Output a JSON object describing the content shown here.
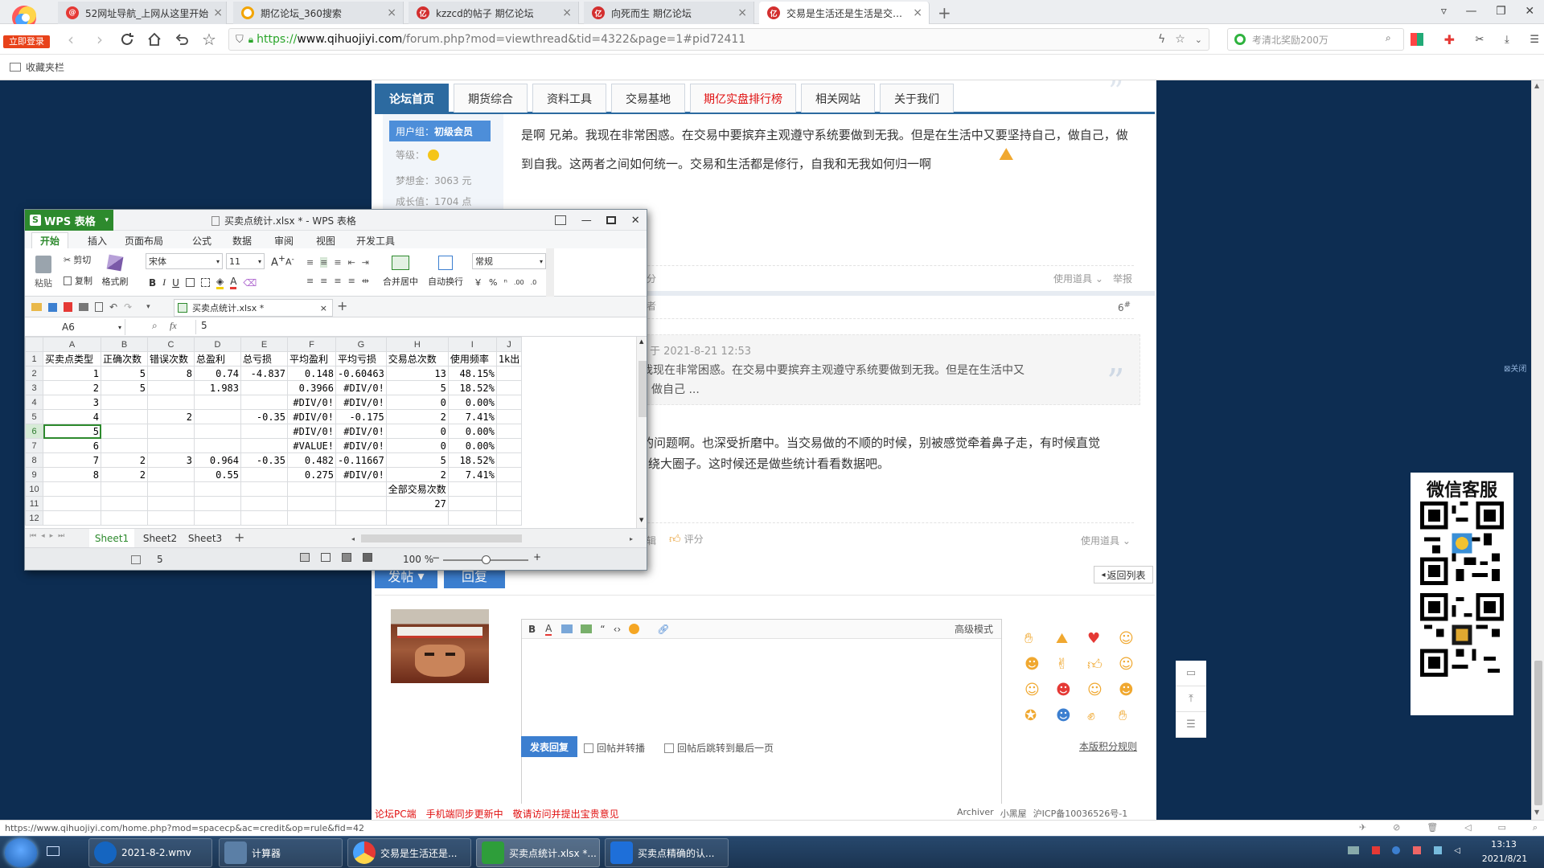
{
  "browser": {
    "login_badge": "立即登录",
    "tabs": [
      {
        "title": "52网址导航_上网从这里开始",
        "icon": "spiral",
        "color": "#e53935"
      },
      {
        "title": "期亿论坛_360搜索",
        "icon": "360",
        "color": "#f2a400"
      },
      {
        "title": "kzzcd的帖子 期亿论坛",
        "icon": "forum",
        "color": "#d32f2f"
      },
      {
        "title": "向死而生 期亿论坛",
        "icon": "forum",
        "color": "#d32f2f"
      },
      {
        "title": "交易是生活还是生活是交易？",
        "icon": "forum",
        "color": "#d32f2f",
        "active": true
      }
    ],
    "url_protocol": "https://",
    "url_host": "www.qihuojiyi.com",
    "url_rest": "/forum.php?mod=viewthread&tid=4322&page=1#pid72411",
    "search_placeholder": "考清北奖励200万",
    "favbar_label": "收藏夹栏"
  },
  "forum": {
    "nav": [
      "论坛首页",
      "期货综合",
      "资料工具",
      "交易基地",
      "期亿实盘排行榜",
      "相关网站",
      "关于我们"
    ],
    "sidebar": {
      "group_label": "用户组：",
      "group_value": "初级会员",
      "level_label": "等级：",
      "coins": "梦想金：3063 元",
      "growth": "成长值：1704 点"
    },
    "post1": {
      "text": "是啊 兄弟。我现在非常困惑。在交易中要摈弃主观遵守系统要做到无我。但是在生活中又要坚持自己，做自己，做到自我。这两者之间如何统一。交易和生活都是修行，自我和无我如何归一啊",
      "rate_partial": "分",
      "tools": "使用道具",
      "report": "举报"
    },
    "post2": {
      "floor": "6",
      "floor_sup": "#",
      "author_partial": "者",
      "quote_time": "于 2021-8-21 12:53",
      "quote_text": "我现在非常困惑。在交易中要摈弃主观遵守系统要做到无我。但是在生活中又",
      "quote_text2": "做自己 ...",
      "reply_text": "的问题啊。也深受折磨中。当交易做的不顺的时候，别被感觉牵着鼻子走，有时候直觉",
      "reply_text2": "绕大圈子。这时候还是做些统计看看数据吧。",
      "edit_partial": "辑",
      "rate": "评分",
      "tools": "使用道具"
    },
    "buttons": {
      "post": "发帖",
      "reply": "回复",
      "back": "返回列表"
    },
    "editor": {
      "advanced": "高级模式",
      "submit": "发表回复",
      "check1": "回帖并转播",
      "check2": "回帖后跳转到最后一页",
      "rules": "本版积分规则"
    },
    "footer_red": "论坛PC端　手机端同步更新中　敬请访问并提出宝贵意见",
    "footer_right1": "Archiver",
    "footer_right2": "小黑屋",
    "footer_right3": "沪ICP备10036526号-1",
    "close_ad": "关闭"
  },
  "wechat": {
    "title": "微信客服"
  },
  "wps": {
    "app_name": "WPS 表格",
    "window_title": "买卖点统计.xlsx * - WPS 表格",
    "ribbon_tabs": [
      "开始",
      "插入",
      "页面布局",
      "公式",
      "数据",
      "审阅",
      "视图",
      "开发工具"
    ],
    "ribbon": {
      "paste": "粘贴",
      "cut": "剪切",
      "copy": "复制",
      "format_painter": "格式刷",
      "font_name": "宋体",
      "font_size": "11",
      "merge": "合并居中",
      "wrap": "自动换行",
      "number_format": "常规"
    },
    "doc_tab": "买卖点统计.xlsx *",
    "name_box": "A6",
    "fx": "fx",
    "formula": "5",
    "columns": [
      "A",
      "B",
      "C",
      "D",
      "E",
      "F",
      "G",
      "H",
      "I",
      "J"
    ],
    "rows": [
      {
        "n": "1",
        "c": [
          "买卖点类型",
          "正确次数",
          "错误次数",
          "总盈利",
          "总亏损",
          "平均盈利",
          "平均亏损",
          "交易总次数",
          "使用频率",
          "1k出"
        ]
      },
      {
        "n": "2",
        "c": [
          "1",
          "5",
          "8",
          "0.74",
          "-4.837",
          "0.148",
          "-0.60463",
          "13",
          "48.15%",
          ""
        ]
      },
      {
        "n": "3",
        "c": [
          "2",
          "5",
          "",
          "1.983",
          "",
          "0.3966",
          "#DIV/0!",
          "5",
          "18.52%",
          ""
        ]
      },
      {
        "n": "4",
        "c": [
          "3",
          "",
          "",
          "",
          "",
          "#DIV/0!",
          "#DIV/0!",
          "0",
          "0.00%",
          ""
        ]
      },
      {
        "n": "5",
        "c": [
          "4",
          "",
          "2",
          "",
          "-0.35",
          "#DIV/0!",
          "-0.175",
          "2",
          "7.41%",
          ""
        ]
      },
      {
        "n": "6",
        "c": [
          "5",
          "",
          "",
          "",
          "",
          "#DIV/0!",
          "#DIV/0!",
          "0",
          "0.00%",
          ""
        ]
      },
      {
        "n": "7",
        "c": [
          "6",
          "",
          "",
          "",
          "",
          "#VALUE!",
          "#DIV/0!",
          "0",
          "0.00%",
          ""
        ]
      },
      {
        "n": "8",
        "c": [
          "7",
          "2",
          "3",
          "0.964",
          "-0.35",
          "0.482",
          "-0.11667",
          "5",
          "18.52%",
          ""
        ]
      },
      {
        "n": "9",
        "c": [
          "8",
          "2",
          "",
          "0.55",
          "",
          "0.275",
          "#DIV/0!",
          "2",
          "7.41%",
          ""
        ]
      },
      {
        "n": "10",
        "c": [
          "",
          "",
          "",
          "",
          "",
          "",
          "",
          "全部交易次数",
          "",
          ""
        ]
      },
      {
        "n": "11",
        "c": [
          "",
          "",
          "",
          "",
          "",
          "",
          "",
          "27",
          "",
          ""
        ]
      },
      {
        "n": "12",
        "c": [
          "",
          "",
          "",
          "",
          "",
          "",
          "",
          "",
          "",
          ""
        ]
      }
    ],
    "sheets": [
      "Sheet1",
      "Sheet2",
      "Sheet3"
    ],
    "status_value": "5",
    "zoom": "100 %",
    "zoom_level": 0.5
  },
  "statusbar_url": "https://www.qihuojiyi.com/home.php?mod=spacecp&ac=credit&op=rule&fid=42",
  "taskbar": {
    "items": [
      {
        "label": "2021-8-2.wmv",
        "color": "#1565c0"
      },
      {
        "label": "计算器",
        "color": "#5b7fa6"
      },
      {
        "label": "交易是生活还是...",
        "color": "#e53935"
      },
      {
        "label": "买卖点统计.xlsx *...",
        "color": "#2e9e3a"
      },
      {
        "label": "买卖点精确的认...",
        "color": "#1e6fd9"
      }
    ],
    "time": "13:13",
    "date": "2021/8/21"
  }
}
